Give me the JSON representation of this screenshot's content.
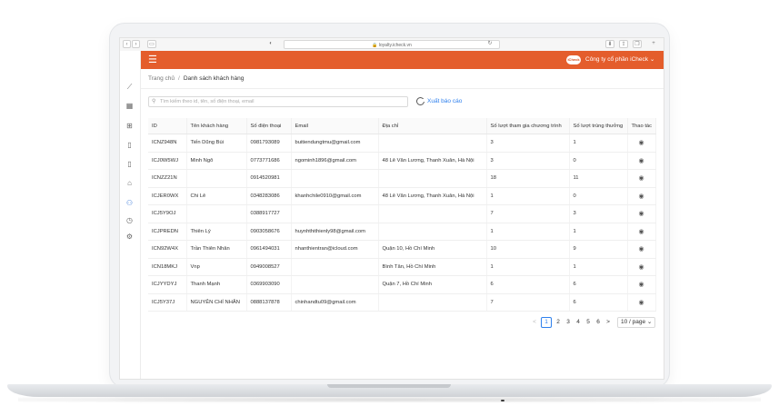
{
  "browser": {
    "url": "loyalty.icheck.vn"
  },
  "header": {
    "brand_logo_text": "iCheck",
    "company": "Công ty cổ phần iCheck ⌄"
  },
  "breadcrumb": {
    "home": "Trang chủ",
    "separator": "/",
    "current": "Danh sách khách hàng"
  },
  "search": {
    "placeholder": "Tìm kiếm theo id, tên, số điện thoại, email"
  },
  "export": {
    "label": "Xuất báo cáo"
  },
  "table": {
    "columns": [
      "ID",
      "Tên khách hàng",
      "Số điện thoại",
      "Email",
      "Địa chỉ",
      "Số lượt tham gia chương trình",
      "Số lượt trúng thưởng",
      "Thao tác"
    ],
    "rows": [
      [
        "ICNZ948N",
        "Tiến Dũng Bùi",
        "0981793089",
        "buitiendungtmu@gmail.com",
        "",
        "3",
        "1"
      ],
      [
        "ICJ0W5WJ",
        "Minh Ngô",
        "0773771686",
        "ngominh1896@gmail.com",
        "48 Lê Văn Lương, Thanh Xuân, Hà Nội",
        "3",
        "0"
      ],
      [
        "ICNZZ21N",
        "",
        "0914520981",
        "",
        "",
        "18",
        "11"
      ],
      [
        "ICJER0WX",
        "Chi Lê",
        "0348283086",
        "khanhchile0910@gmail.com",
        "48 Lê Văn Lương, Thanh Xuân, Hà Nội",
        "1",
        "0"
      ],
      [
        "ICJ5Y9OJ",
        "",
        "0388917727",
        "",
        "",
        "7",
        "3"
      ],
      [
        "ICJPREDN",
        "Thiên Lý",
        "0903058676",
        "huynhthithienly98@gmail.com",
        "",
        "1",
        "1"
      ],
      [
        "ICN92W4X",
        "Trần Thiên Nhân",
        "0961494031",
        "nhanthientran@icloud.com",
        "Quận 10, Hồ Chí Minh",
        "10",
        "9"
      ],
      [
        "ICN18MKJ",
        "Vnp",
        "0949008527",
        "",
        "Bình Tân, Hồ Chí Minh",
        "1",
        "1"
      ],
      [
        "ICJYYDYJ",
        "Thanh Mạnh",
        "0369903090",
        "",
        "Quận 7, Hồ Chí Minh",
        "6",
        "6"
      ],
      [
        "ICJ5Y37J",
        "NGUYỄN CHÍ NHÂN",
        "0888137878",
        "chinhandtu09@gmail.com",
        "",
        "7",
        "6"
      ]
    ],
    "action_icon": "eye-icon"
  },
  "pagination": {
    "prev": "<",
    "pages": [
      "1",
      "2",
      "3",
      "4",
      "5",
      "6"
    ],
    "active": "1",
    "next": ">",
    "page_size": "10 / page ⌄"
  },
  "colors": {
    "header": "#e45d2c",
    "accent": "#2f80ed"
  }
}
